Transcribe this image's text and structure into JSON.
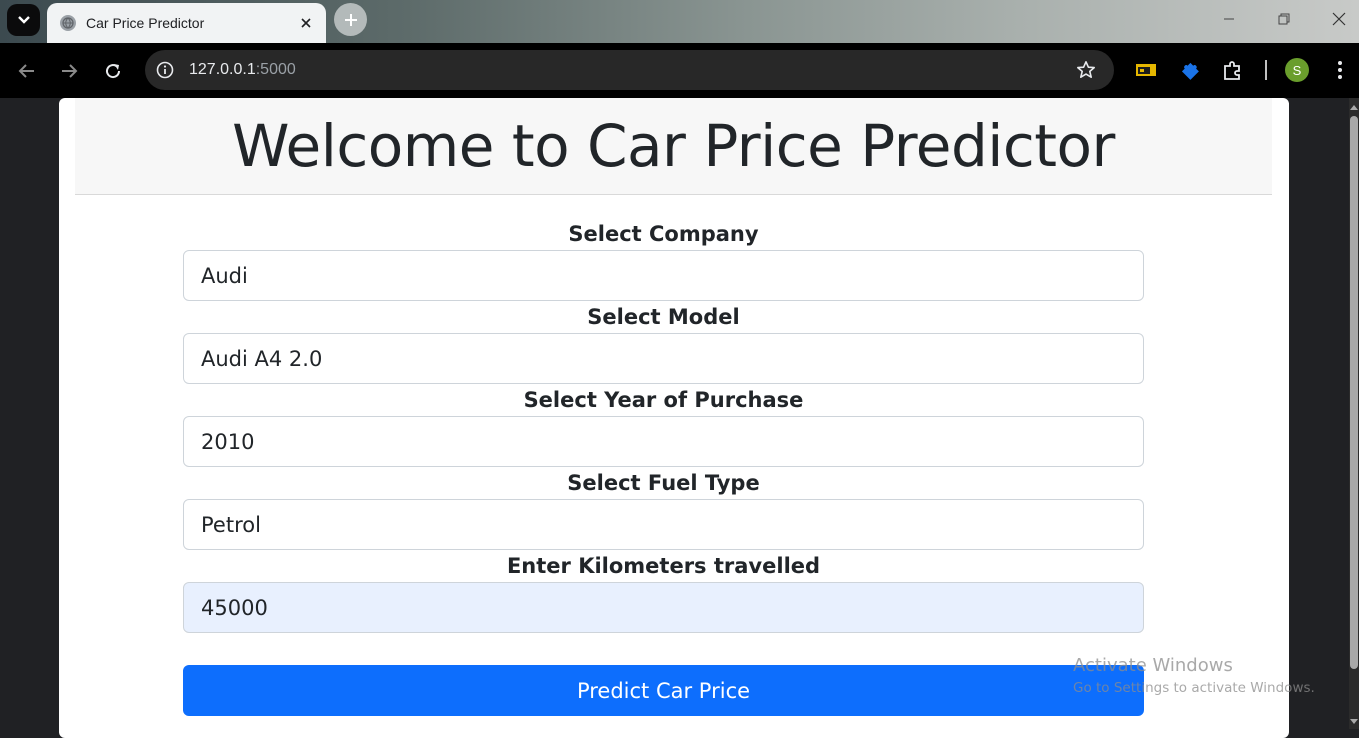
{
  "browser": {
    "tab_title": "Car Price Predictor",
    "url_host": "127.0.0.1",
    "url_port": ":5000",
    "profile_initial": "S"
  },
  "page": {
    "heading": "Welcome to Car Price Predictor",
    "fields": [
      {
        "label": "Select Company",
        "value": "Audi"
      },
      {
        "label": "Select Model",
        "value": "Audi A4 2.0"
      },
      {
        "label": "Select Year of Purchase",
        "value": "2010"
      },
      {
        "label": "Select Fuel Type",
        "value": "Petrol"
      },
      {
        "label": "Enter Kilometers travelled",
        "value": "45000"
      }
    ],
    "submit_label": "Predict Car Price"
  },
  "watermark": {
    "line1": "Activate Windows",
    "line2": "Go to Settings to activate Windows."
  },
  "colors": {
    "primary_button": "#0d6efd",
    "autofill_bg": "#e8f0fe",
    "avatar": "#6a9e2c"
  },
  "icons": [
    "tab-search-icon",
    "globe-icon",
    "close-icon",
    "plus-icon",
    "minimize-icon",
    "restore-icon",
    "back-arrow-icon",
    "forward-arrow-icon",
    "reload-icon",
    "info-icon",
    "star-icon",
    "cast-icon",
    "puzzle-extension-icon",
    "extensions-icon",
    "more-vert-icon"
  ]
}
